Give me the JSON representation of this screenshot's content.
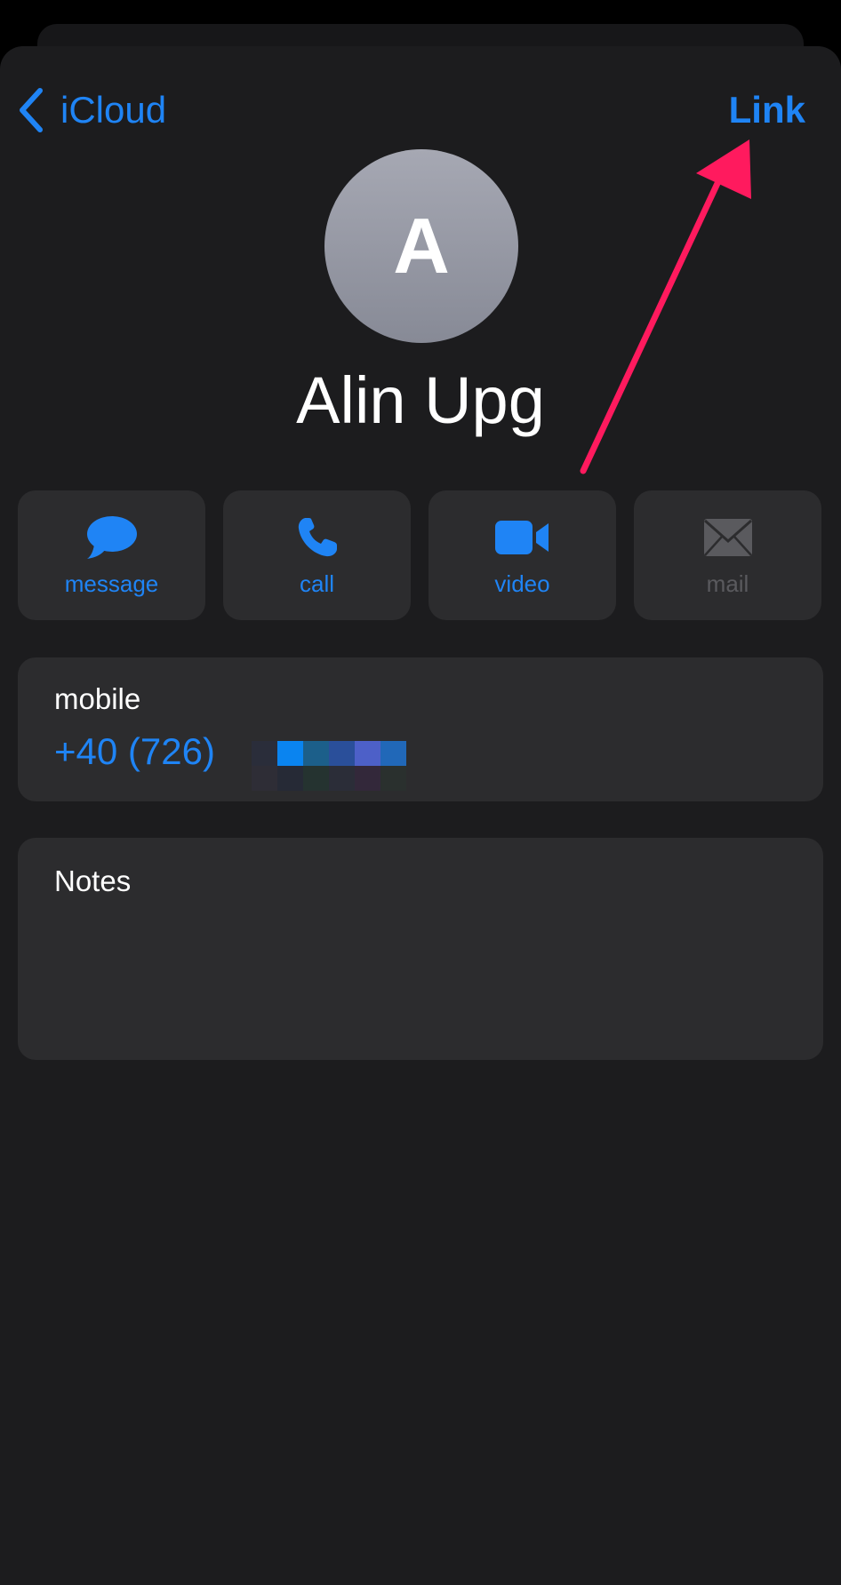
{
  "nav": {
    "back_label": "iCloud",
    "action_label": "Link"
  },
  "contact": {
    "avatar_initial": "A",
    "name": "Alin Upg"
  },
  "actions": [
    {
      "label": "message",
      "icon": "message-bubble-icon",
      "enabled": true
    },
    {
      "label": "call",
      "icon": "phone-icon",
      "enabled": true
    },
    {
      "label": "video",
      "icon": "video-camera-icon",
      "enabled": true
    },
    {
      "label": "mail",
      "icon": "envelope-icon",
      "enabled": false
    }
  ],
  "phone": {
    "label": "mobile",
    "number_visible": "+40 (726)"
  },
  "notes": {
    "label": "Notes"
  },
  "colors": {
    "accent": "#1f84f5",
    "annotation_arrow": "#ff1a5e",
    "background": "#1c1c1e",
    "card": "#2c2c2e",
    "disabled": "#5a5a5e"
  }
}
